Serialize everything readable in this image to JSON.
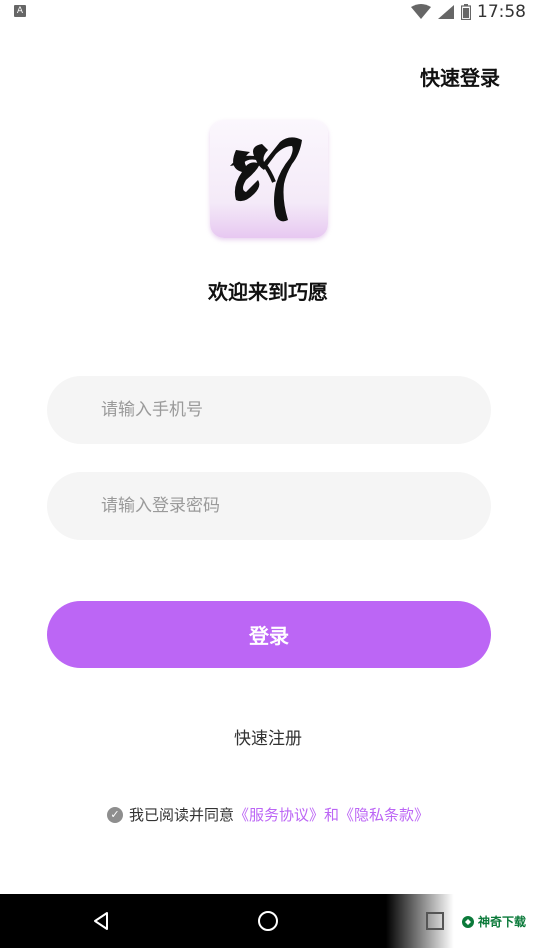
{
  "status_bar": {
    "time": "17:58",
    "left_icon": "A",
    "icons": [
      "wifi-icon",
      "signal-icon",
      "battery-icon"
    ]
  },
  "header": {
    "quick_login_label": "快速登录"
  },
  "logo": {
    "icon": "app-logo-icon",
    "accent": "#e7c8f1"
  },
  "welcome_text": "欢迎来到巧愿",
  "form": {
    "phone": {
      "placeholder": "请输入手机号",
      "value": ""
    },
    "password": {
      "placeholder": "请输入登录密码",
      "value": ""
    },
    "login_label": "登录"
  },
  "register_label": "快速注册",
  "agreement": {
    "prefix": "我已阅读并同意",
    "service_link": "《服务协议》",
    "conjunction": "和",
    "privacy_link": "《隐私条款》"
  },
  "nav_bar": {
    "icons": [
      "back-icon",
      "home-icon",
      "recent-apps-icon"
    ]
  },
  "watermark": {
    "text": "神奇下载"
  },
  "colors": {
    "accent": "#bc66f5",
    "field_bg": "#f5f5f5",
    "placeholder": "#9a9a9a"
  }
}
